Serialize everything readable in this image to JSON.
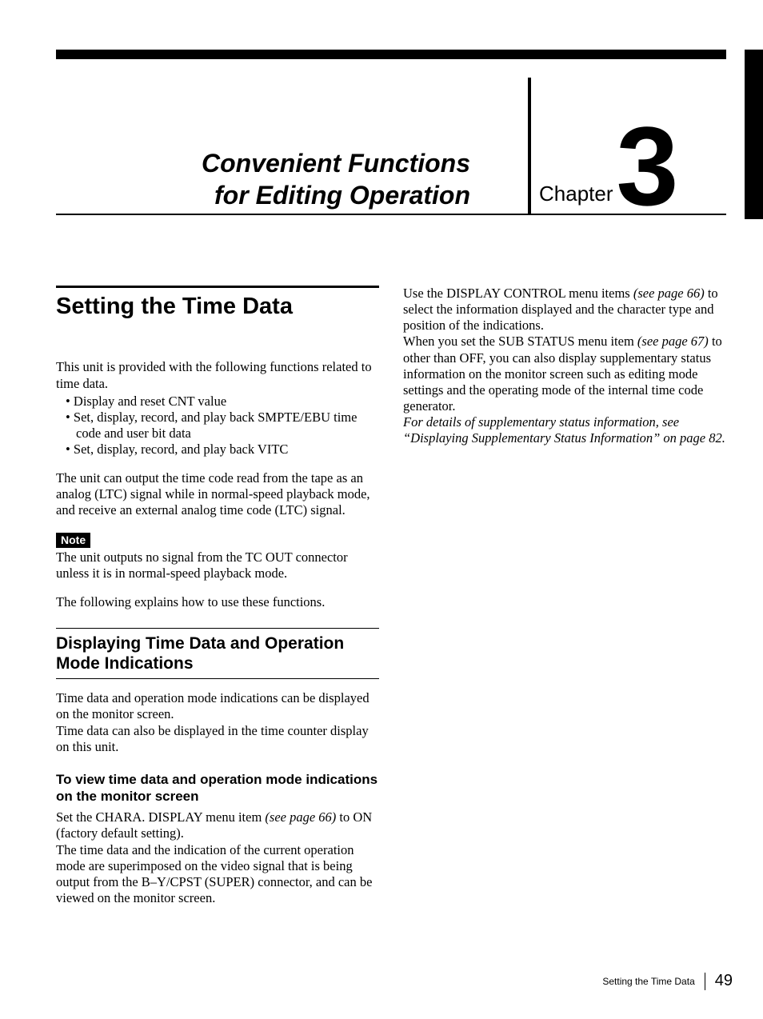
{
  "chapter": {
    "title_line1": "Convenient Functions",
    "title_line2": "for Editing Operation",
    "label": "Chapter",
    "number": "3"
  },
  "left": {
    "h1": "Setting the Time Data",
    "intro": "This unit is provided with the following functions related to time data.",
    "bullets": [
      "Display and reset CNT value",
      "Set, display, record, and play back SMPTE/EBU time code and user bit data",
      "Set, display, record, and play back VITC"
    ],
    "p2": "The unit can output the time code read from the tape as an analog (LTC) signal while in normal-speed playback mode, and receive an external analog time code (LTC) signal.",
    "note_label": "Note",
    "note_body": "The unit outputs no signal from the TC OUT connector unless it is in normal-speed playback mode.",
    "p3": "The following explains how to use these functions.",
    "h2": "Displaying Time Data and Operation Mode Indications",
    "p4a": "Time data and operation mode indications can be displayed on the monitor screen.",
    "p4b": "Time data can also be displayed in the time counter display on this unit.",
    "h3": "To view time data and operation mode indications on the monitor screen",
    "p5a_pre": "Set the CHARA. DISPLAY menu item ",
    "p5a_ref": "(see page 66)",
    "p5a_post": " to ON (factory default setting).",
    "p5b": "The time data and the indication of the current operation mode are superimposed on the video signal that is being output from the B–Y/CPST (SUPER) connector, and can be viewed on the monitor screen."
  },
  "right": {
    "p1_pre": "Use the DISPLAY CONTROL menu items ",
    "p1_ref": "(see page 66)",
    "p1_post": " to select the information displayed and the character type and position of the indications.",
    "p2_pre": "When you set the SUB STATUS menu item ",
    "p2_ref": "(see page 67)",
    "p2_post": " to other than OFF, you can also display supplementary status information on the monitor screen such as editing mode settings and the operating mode of the internal time code generator.",
    "p3": "For details of supplementary status information, see “Displaying Supplementary Status Information” on page 82."
  },
  "footer": {
    "title": "Setting the Time Data",
    "page": "49"
  }
}
